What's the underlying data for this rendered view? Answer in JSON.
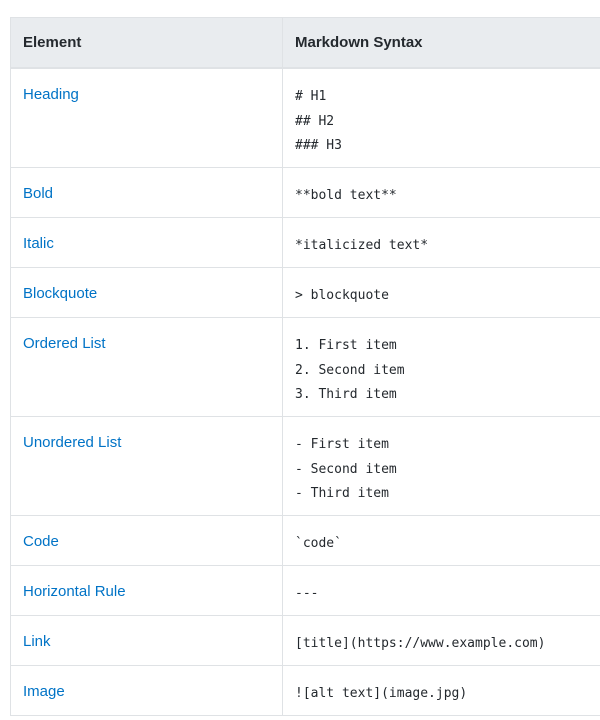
{
  "table": {
    "headers": [
      "Element",
      "Markdown Syntax"
    ],
    "rows": [
      {
        "element": "Heading",
        "syntax": [
          "# H1",
          "## H2",
          "### H3"
        ]
      },
      {
        "element": "Bold",
        "syntax": [
          "**bold text**"
        ]
      },
      {
        "element": "Italic",
        "syntax": [
          "*italicized text*"
        ]
      },
      {
        "element": "Blockquote",
        "syntax": [
          "> blockquote"
        ]
      },
      {
        "element": "Ordered List",
        "syntax": [
          "1. First item",
          "2. Second item",
          "3. Third item"
        ]
      },
      {
        "element": "Unordered List",
        "syntax": [
          "- First item",
          "- Second item",
          "- Third item"
        ]
      },
      {
        "element": "Code",
        "syntax": [
          "`code`"
        ]
      },
      {
        "element": "Horizontal Rule",
        "syntax": [
          "---"
        ]
      },
      {
        "element": "Link",
        "syntax": [
          "[title](https://www.example.com)"
        ]
      },
      {
        "element": "Image",
        "syntax": [
          "![alt text](image.jpg)"
        ]
      }
    ]
  },
  "colors": {
    "link": "#0073c6",
    "header_bg": "#e9ecef",
    "border": "#dfe2e5",
    "text": "#24292e"
  }
}
